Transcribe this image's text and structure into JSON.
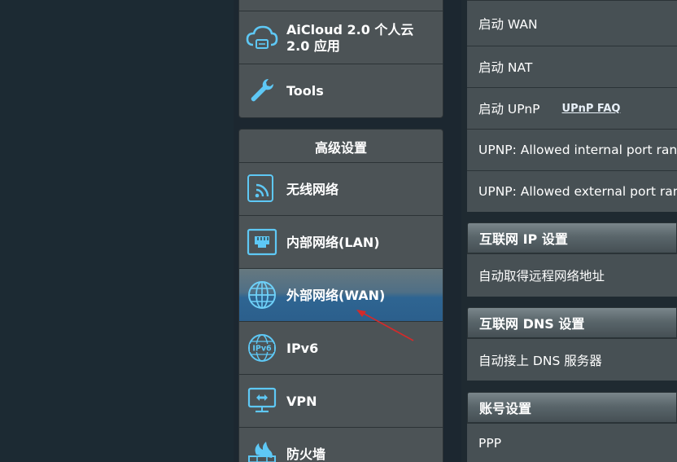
{
  "sidebar": {
    "top_items": [
      {
        "label_line1": "AiCloud 2.0 个人云",
        "label_line2": "2.0 应用",
        "icon": "cloud-icon"
      },
      {
        "label": "Tools",
        "icon": "wrench-icon"
      }
    ],
    "advanced": {
      "header": "高级设置",
      "items": [
        {
          "label": "无线网络",
          "icon": "wireless-icon"
        },
        {
          "label": "内部网络(LAN)",
          "icon": "lan-icon"
        },
        {
          "label": "外部网络(WAN)",
          "icon": "globe-icon",
          "active": true
        },
        {
          "label": "IPv6",
          "icon": "ipv6-globe-icon"
        },
        {
          "label": "VPN",
          "icon": "vpn-icon"
        },
        {
          "label": "防火墙",
          "icon": "firewall-icon"
        }
      ]
    }
  },
  "content": {
    "rows_top": [
      {
        "label": "启动 WAN"
      },
      {
        "label": "启动 NAT"
      },
      {
        "label": "启动 UPnP",
        "link": "UPnP  FAQ"
      },
      {
        "label": "UPNP: Allowed internal port range"
      },
      {
        "label": "UPNP: Allowed external port range"
      }
    ],
    "section_ip": {
      "title": "互联网 IP 设置",
      "row": "自动取得远程网络地址"
    },
    "section_dns": {
      "title": "互联网 DNS 设置",
      "row": "自动接上 DNS 服务器"
    },
    "section_account": {
      "title": "账号设置",
      "row": "PPP"
    }
  },
  "colors": {
    "accent_active": "#2c5f8c",
    "icon_blue": "#5ec8f5",
    "arrow": "#d42a2a"
  }
}
